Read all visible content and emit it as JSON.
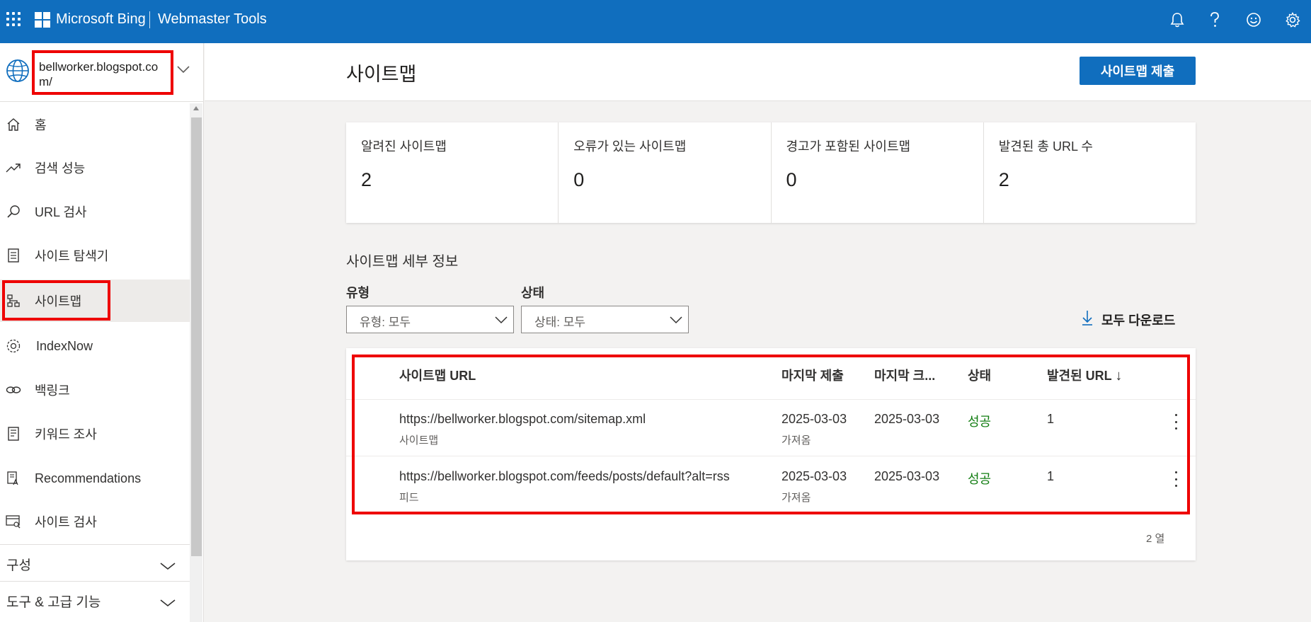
{
  "topbar": {
    "brand": "Microsoft Bing",
    "product": "Webmaster Tools",
    "icons": [
      "bell-icon",
      "help-icon",
      "feedback-smiley-icon",
      "settings-gear-icon"
    ],
    "color": "#106ebe"
  },
  "sidebar": {
    "site": "bellworker.blogspot.com/",
    "items": [
      {
        "label": "홈",
        "icon": "home-icon"
      },
      {
        "label": "검색 성능",
        "icon": "trending-icon"
      },
      {
        "label": "URL 검사",
        "icon": "search-icon"
      },
      {
        "label": "사이트 탐색기",
        "icon": "document-list-icon"
      },
      {
        "label": "사이트맵",
        "icon": "sitemap-icon"
      },
      {
        "label": "IndexNow",
        "icon": "gear-icon"
      },
      {
        "label": "백링크",
        "icon": "link-icon"
      },
      {
        "label": "키워드 조사",
        "icon": "keyword-doc-icon"
      },
      {
        "label": "Recommendations",
        "icon": "recommendations-icon"
      },
      {
        "label": "사이트 검사",
        "icon": "site-scan-icon"
      }
    ],
    "groups": [
      {
        "label": "구성"
      },
      {
        "label": "도구 & 고급 기능"
      }
    ]
  },
  "main": {
    "title": "사이트맵",
    "submit_label": "사이트맵 제출",
    "stats": [
      {
        "label": "알려진 사이트맵",
        "value": "2"
      },
      {
        "label": "오류가 있는 사이트맵",
        "value": "0"
      },
      {
        "label": "경고가 포함된 사이트맵",
        "value": "0"
      },
      {
        "label": "발견된 총 URL 수",
        "value": "2"
      }
    ],
    "details_title": "사이트맵 세부 정보",
    "filters": {
      "type_label": "유형",
      "type_value": "유형: 모두",
      "status_label": "상태",
      "status_value": "상태: 모두"
    },
    "download_label": "모두 다운로드",
    "table": {
      "headers": {
        "url": "사이트맵 URL",
        "last_submitted": "마지막 제출",
        "last_crawled": "마지막 크...",
        "status": "상태",
        "discovered": "발견된 URL",
        "sort_arrow": "↓"
      },
      "rows": [
        {
          "url": "https://bellworker.blogspot.com/sitemap.xml",
          "type": "사이트맵",
          "submitted": "2025-03-03",
          "submitted_sub": "가져옴",
          "crawled": "2025-03-03",
          "status": "성공",
          "discovered": "1"
        },
        {
          "url": "https://bellworker.blogspot.com/feeds/posts/default?alt=rss",
          "type": "피드",
          "submitted": "2025-03-03",
          "submitted_sub": "가져옴",
          "crawled": "2025-03-03",
          "status": "성공",
          "discovered": "1"
        }
      ],
      "row_count": "2 열"
    }
  }
}
